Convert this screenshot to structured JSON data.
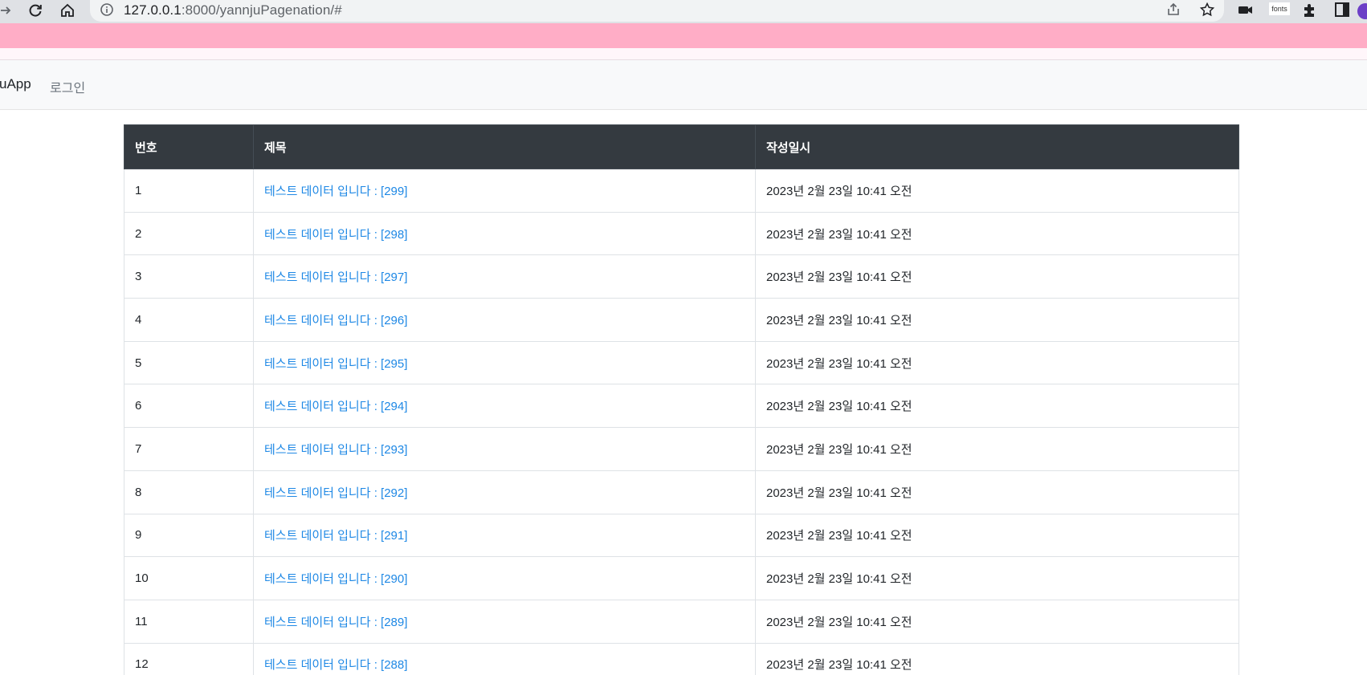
{
  "browser": {
    "url_host": "127.0.0.1",
    "url_path": ":8000/yannjuPagenation/#",
    "extension_badge": "fonts"
  },
  "navbar": {
    "brand": "uApp",
    "login_link": "로그인"
  },
  "table": {
    "headers": [
      "번호",
      "제목",
      "작성일시"
    ],
    "rows": [
      {
        "num": "1",
        "title": "테스트 데이터 입니다 : [299]",
        "date": "2023년 2월 23일 10:41 오전"
      },
      {
        "num": "2",
        "title": "테스트 데이터 입니다 : [298]",
        "date": "2023년 2월 23일 10:41 오전"
      },
      {
        "num": "3",
        "title": "테스트 데이터 입니다 : [297]",
        "date": "2023년 2월 23일 10:41 오전"
      },
      {
        "num": "4",
        "title": "테스트 데이터 입니다 : [296]",
        "date": "2023년 2월 23일 10:41 오전"
      },
      {
        "num": "5",
        "title": "테스트 데이터 입니다 : [295]",
        "date": "2023년 2월 23일 10:41 오전"
      },
      {
        "num": "6",
        "title": "테스트 데이터 입니다 : [294]",
        "date": "2023년 2월 23일 10:41 오전"
      },
      {
        "num": "7",
        "title": "테스트 데이터 입니다 : [293]",
        "date": "2023년 2월 23일 10:41 오전"
      },
      {
        "num": "8",
        "title": "테스트 데이터 입니다 : [292]",
        "date": "2023년 2월 23일 10:41 오전"
      },
      {
        "num": "9",
        "title": "테스트 데이터 입니다 : [291]",
        "date": "2023년 2월 23일 10:41 오전"
      },
      {
        "num": "10",
        "title": "테스트 데이터 입니다 : [290]",
        "date": "2023년 2월 23일 10:41 오전"
      },
      {
        "num": "11",
        "title": "테스트 데이터 입니다 : [289]",
        "date": "2023년 2월 23일 10:41 오전"
      },
      {
        "num": "12",
        "title": "테스트 데이터 입니다 : [288]",
        "date": "2023년 2월 23일 10:41 오전"
      }
    ]
  },
  "colors": {
    "header_bg": "#343a40",
    "link": "#1e88e5",
    "bookmark_bar": "#ffadc6",
    "navbar_bg": "#f8f9fa"
  }
}
